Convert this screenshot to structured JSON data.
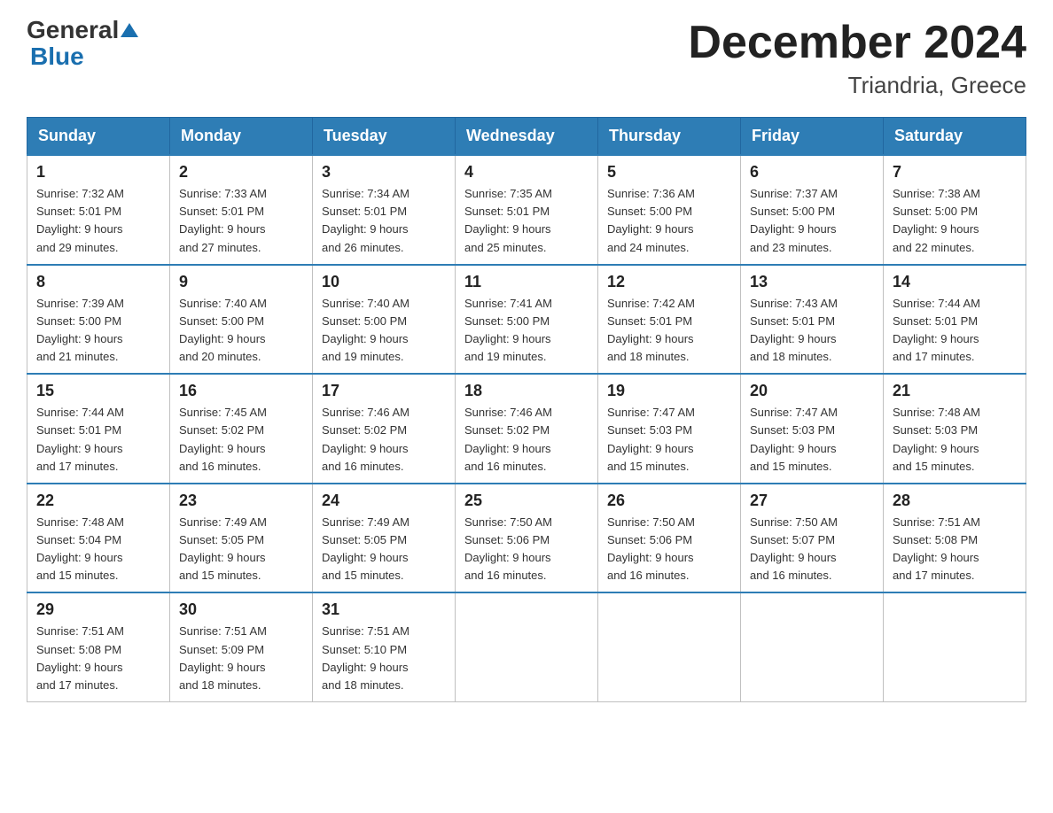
{
  "logo": {
    "text1": "General",
    "text2": "Blue"
  },
  "title": "December 2024",
  "subtitle": "Triandria, Greece",
  "days_of_week": [
    "Sunday",
    "Monday",
    "Tuesday",
    "Wednesday",
    "Thursday",
    "Friday",
    "Saturday"
  ],
  "weeks": [
    [
      {
        "day": "1",
        "sunrise": "7:32 AM",
        "sunset": "5:01 PM",
        "daylight": "9 hours and 29 minutes."
      },
      {
        "day": "2",
        "sunrise": "7:33 AM",
        "sunset": "5:01 PM",
        "daylight": "9 hours and 27 minutes."
      },
      {
        "day": "3",
        "sunrise": "7:34 AM",
        "sunset": "5:01 PM",
        "daylight": "9 hours and 26 minutes."
      },
      {
        "day": "4",
        "sunrise": "7:35 AM",
        "sunset": "5:01 PM",
        "daylight": "9 hours and 25 minutes."
      },
      {
        "day": "5",
        "sunrise": "7:36 AM",
        "sunset": "5:00 PM",
        "daylight": "9 hours and 24 minutes."
      },
      {
        "day": "6",
        "sunrise": "7:37 AM",
        "sunset": "5:00 PM",
        "daylight": "9 hours and 23 minutes."
      },
      {
        "day": "7",
        "sunrise": "7:38 AM",
        "sunset": "5:00 PM",
        "daylight": "9 hours and 22 minutes."
      }
    ],
    [
      {
        "day": "8",
        "sunrise": "7:39 AM",
        "sunset": "5:00 PM",
        "daylight": "9 hours and 21 minutes."
      },
      {
        "day": "9",
        "sunrise": "7:40 AM",
        "sunset": "5:00 PM",
        "daylight": "9 hours and 20 minutes."
      },
      {
        "day": "10",
        "sunrise": "7:40 AM",
        "sunset": "5:00 PM",
        "daylight": "9 hours and 19 minutes."
      },
      {
        "day": "11",
        "sunrise": "7:41 AM",
        "sunset": "5:00 PM",
        "daylight": "9 hours and 19 minutes."
      },
      {
        "day": "12",
        "sunrise": "7:42 AM",
        "sunset": "5:01 PM",
        "daylight": "9 hours and 18 minutes."
      },
      {
        "day": "13",
        "sunrise": "7:43 AM",
        "sunset": "5:01 PM",
        "daylight": "9 hours and 18 minutes."
      },
      {
        "day": "14",
        "sunrise": "7:44 AM",
        "sunset": "5:01 PM",
        "daylight": "9 hours and 17 minutes."
      }
    ],
    [
      {
        "day": "15",
        "sunrise": "7:44 AM",
        "sunset": "5:01 PM",
        "daylight": "9 hours and 17 minutes."
      },
      {
        "day": "16",
        "sunrise": "7:45 AM",
        "sunset": "5:02 PM",
        "daylight": "9 hours and 16 minutes."
      },
      {
        "day": "17",
        "sunrise": "7:46 AM",
        "sunset": "5:02 PM",
        "daylight": "9 hours and 16 minutes."
      },
      {
        "day": "18",
        "sunrise": "7:46 AM",
        "sunset": "5:02 PM",
        "daylight": "9 hours and 16 minutes."
      },
      {
        "day": "19",
        "sunrise": "7:47 AM",
        "sunset": "5:03 PM",
        "daylight": "9 hours and 15 minutes."
      },
      {
        "day": "20",
        "sunrise": "7:47 AM",
        "sunset": "5:03 PM",
        "daylight": "9 hours and 15 minutes."
      },
      {
        "day": "21",
        "sunrise": "7:48 AM",
        "sunset": "5:03 PM",
        "daylight": "9 hours and 15 minutes."
      }
    ],
    [
      {
        "day": "22",
        "sunrise": "7:48 AM",
        "sunset": "5:04 PM",
        "daylight": "9 hours and 15 minutes."
      },
      {
        "day": "23",
        "sunrise": "7:49 AM",
        "sunset": "5:05 PM",
        "daylight": "9 hours and 15 minutes."
      },
      {
        "day": "24",
        "sunrise": "7:49 AM",
        "sunset": "5:05 PM",
        "daylight": "9 hours and 15 minutes."
      },
      {
        "day": "25",
        "sunrise": "7:50 AM",
        "sunset": "5:06 PM",
        "daylight": "9 hours and 16 minutes."
      },
      {
        "day": "26",
        "sunrise": "7:50 AM",
        "sunset": "5:06 PM",
        "daylight": "9 hours and 16 minutes."
      },
      {
        "day": "27",
        "sunrise": "7:50 AM",
        "sunset": "5:07 PM",
        "daylight": "9 hours and 16 minutes."
      },
      {
        "day": "28",
        "sunrise": "7:51 AM",
        "sunset": "5:08 PM",
        "daylight": "9 hours and 17 minutes."
      }
    ],
    [
      {
        "day": "29",
        "sunrise": "7:51 AM",
        "sunset": "5:08 PM",
        "daylight": "9 hours and 17 minutes."
      },
      {
        "day": "30",
        "sunrise": "7:51 AM",
        "sunset": "5:09 PM",
        "daylight": "9 hours and 18 minutes."
      },
      {
        "day": "31",
        "sunrise": "7:51 AM",
        "sunset": "5:10 PM",
        "daylight": "9 hours and 18 minutes."
      },
      null,
      null,
      null,
      null
    ]
  ]
}
